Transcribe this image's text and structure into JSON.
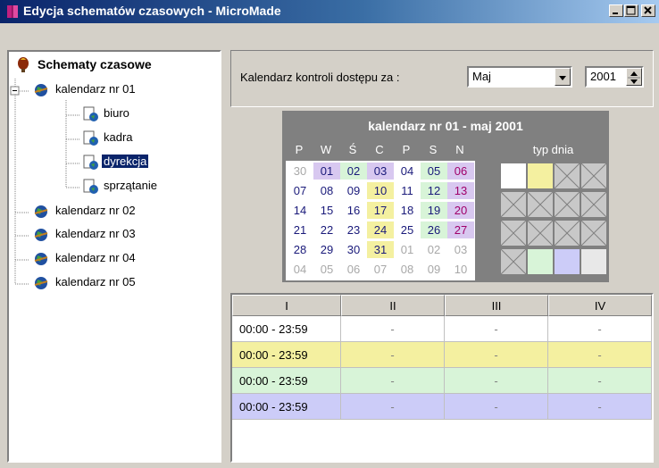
{
  "window": {
    "title": "Edycja schematów czasowych - MicroMade",
    "controls": [
      "minimize",
      "maximize",
      "close"
    ]
  },
  "tree": {
    "root_label": "Schematy czasowe",
    "calendars": [
      {
        "label": "kalendarz nr 01",
        "expanded": true,
        "children": [
          {
            "label": "biuro"
          },
          {
            "label": "kadra"
          },
          {
            "label": "dyrekcja",
            "selected": true
          },
          {
            "label": "sprzątanie"
          }
        ]
      },
      {
        "label": "kalendarz nr 02"
      },
      {
        "label": "kalendarz nr 03"
      },
      {
        "label": "kalendarz nr 04"
      },
      {
        "label": "kalendarz nr 05"
      }
    ]
  },
  "control": {
    "label": "Kalendarz kontroli dostępu za :",
    "month": "Maj",
    "year": "2001"
  },
  "calendar": {
    "title": "kalendarz nr 01 - maj 2001",
    "day_headers": [
      "P",
      "W",
      "Ś",
      "C",
      "P",
      "S",
      "N"
    ],
    "typ_label": "typ dnia",
    "weeks": [
      [
        {
          "d": "30",
          "dim": true
        },
        {
          "d": "01",
          "bg": "#d8c8f0"
        },
        {
          "d": "02",
          "bg": "#d8f4d8"
        },
        {
          "d": "03",
          "bg": "#d8c8f0"
        },
        {
          "d": "04"
        },
        {
          "d": "05",
          "bg": "#d8f4d8"
        },
        {
          "d": "06",
          "bg": "#d8c8f0"
        }
      ],
      [
        {
          "d": "07"
        },
        {
          "d": "08"
        },
        {
          "d": "09"
        },
        {
          "d": "10",
          "bg": "#f4f0a0"
        },
        {
          "d": "11"
        },
        {
          "d": "12",
          "bg": "#d8f4d8"
        },
        {
          "d": "13",
          "bg": "#d8c8f0"
        }
      ],
      [
        {
          "d": "14"
        },
        {
          "d": "15"
        },
        {
          "d": "16"
        },
        {
          "d": "17",
          "bg": "#f4f0a0"
        },
        {
          "d": "18"
        },
        {
          "d": "19",
          "bg": "#d8f4d8"
        },
        {
          "d": "20",
          "bg": "#d8c8f0"
        }
      ],
      [
        {
          "d": "21"
        },
        {
          "d": "22"
        },
        {
          "d": "23"
        },
        {
          "d": "24",
          "bg": "#f4f0a0"
        },
        {
          "d": "25"
        },
        {
          "d": "26",
          "bg": "#d8f4d8"
        },
        {
          "d": "27",
          "bg": "#d8c8f0"
        }
      ],
      [
        {
          "d": "28"
        },
        {
          "d": "29"
        },
        {
          "d": "30"
        },
        {
          "d": "31",
          "bg": "#f4f0a0"
        },
        {
          "d": "01",
          "dim": true
        },
        {
          "d": "02",
          "dim": true
        },
        {
          "d": "03",
          "dim": true
        }
      ],
      [
        {
          "d": "04",
          "dim": true
        },
        {
          "d": "05",
          "dim": true
        },
        {
          "d": "06",
          "dim": true
        },
        {
          "d": "07",
          "dim": true
        },
        {
          "d": "08",
          "dim": true
        },
        {
          "d": "09",
          "dim": true
        },
        {
          "d": "10",
          "dim": true
        }
      ]
    ],
    "day_types": [
      [
        "#ffffff",
        "#f4f0a0",
        "x",
        "x"
      ],
      [
        "x",
        "x",
        "x",
        "x"
      ],
      [
        "x",
        "x",
        "x",
        "x"
      ],
      [
        "x",
        "#d8f4d8",
        "#ccccf8",
        "#e8e8e8"
      ]
    ]
  },
  "schedule": {
    "columns": [
      "I",
      "II",
      "III",
      "IV"
    ],
    "rows": [
      {
        "bg": "#ffffff",
        "cells": [
          "00:00 - 23:59",
          "-",
          "-",
          "-"
        ]
      },
      {
        "bg": "#f4f0a0",
        "cells": [
          "00:00 - 23:59",
          "-",
          "-",
          "-"
        ]
      },
      {
        "bg": "#d8f4d8",
        "cells": [
          "00:00 - 23:59",
          "-",
          "-",
          "-"
        ]
      },
      {
        "bg": "#ccccf8",
        "cells": [
          "00:00 - 23:59",
          "-",
          "-",
          "-"
        ]
      }
    ]
  },
  "icons": {
    "app": "book-icon",
    "root": "balloon-icon",
    "calendar": "globe-icon",
    "schedule": "schedule-page-icon"
  }
}
